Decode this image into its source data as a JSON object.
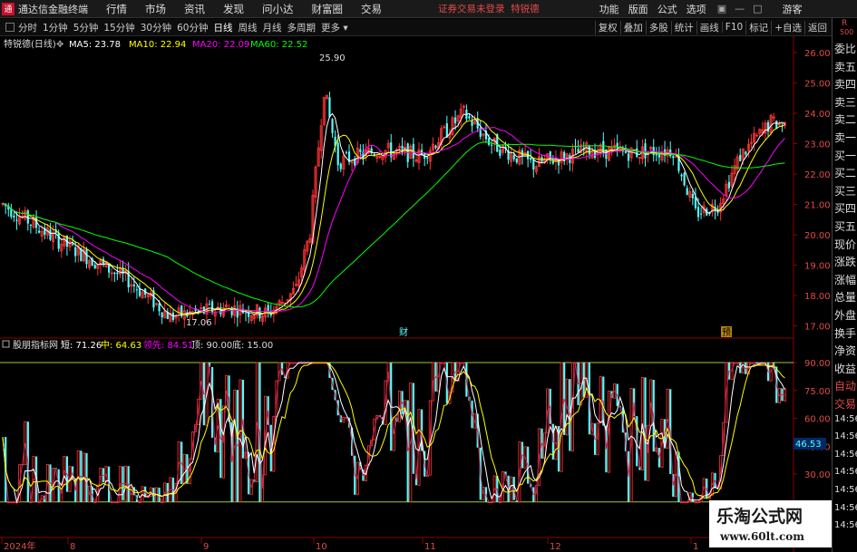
{
  "menubar": {
    "app_title": "通达信金融终端",
    "items": [
      "行情",
      "市场",
      "资讯",
      "发现",
      "问小达",
      "财富圈",
      "交易"
    ],
    "login_status": "证券交易未登录",
    "stock_name": "特锐德",
    "right_items": [
      "功能",
      "版面",
      "公式",
      "选项"
    ],
    "guest": "游客"
  },
  "toolbar": {
    "periods": [
      "分时",
      "1分钟",
      "5分钟",
      "15分钟",
      "30分钟",
      "60分钟",
      "日线",
      "周线",
      "月线",
      "多周期",
      "更多"
    ],
    "active_period": "日线",
    "tools": [
      "复权",
      "叠加",
      "多股",
      "统计",
      "画线",
      "F10",
      "标记",
      "+自选",
      "返回"
    ]
  },
  "main_chart": {
    "title": "特锐德(日线)",
    "ma": [
      {
        "label": "MA5: 23.78",
        "color": "#ffffff"
      },
      {
        "label": "MA10: 22.94",
        "color": "#ffff00"
      },
      {
        "label": "MA20: 22.09",
        "color": "#ff00ff"
      },
      {
        "label": "MA60: 22.52",
        "color": "#00ff00"
      }
    ],
    "y_ticks": [
      "26.00",
      "25.00",
      "24.00",
      "23.00",
      "22.00",
      "21.00",
      "20.00",
      "19.00",
      "18.00",
      "17.00"
    ],
    "high_label": "25.90",
    "low_label": "17.06",
    "event_label_1": "财",
    "event_label_2": "预"
  },
  "sub_chart": {
    "title": "股朋指标网",
    "items": [
      {
        "label": "短: 71.26",
        "color": "#ffffff"
      },
      {
        "label": "中: 64.63",
        "color": "#ffff00"
      },
      {
        "label": "领先: 84.51",
        "color": "#ff00ff"
      },
      {
        "label": "顶: 90.00",
        "color": "#dddddd"
      },
      {
        "label": "底: 15.00",
        "color": "#dddddd"
      }
    ],
    "y_ticks": [
      "90.00",
      "75.00",
      "60.00",
      "45.00",
      "30.00"
    ],
    "current_value": "46.53"
  },
  "x_axis": {
    "labels": [
      "2024年",
      "8",
      "9",
      "10",
      "11",
      "12",
      "1"
    ]
  },
  "right_panel": {
    "corner": "R",
    "corner_num": "500",
    "items": [
      "委比",
      "卖五",
      "卖四",
      "卖三",
      "卖二",
      "卖一",
      "买一",
      "买二",
      "买三",
      "买四",
      "买五",
      "现价",
      "涨跌",
      "涨幅",
      "总量",
      "外盘",
      "换手",
      "净资",
      "收益",
      "自动",
      "交易",
      "14:56",
      "14:56",
      "14:56",
      "14:56",
      "14:56",
      "14:56",
      "14:56"
    ]
  },
  "watermark": {
    "title": "乐淘公式网",
    "url": "www.60lt.com"
  },
  "colors": {
    "up": "#ff3333",
    "down": "#54ffff",
    "ma5": "#ffffff",
    "ma10": "#ffff00",
    "ma20": "#ff00ff",
    "ma60": "#00ff00",
    "grid": "#8b0000"
  }
}
